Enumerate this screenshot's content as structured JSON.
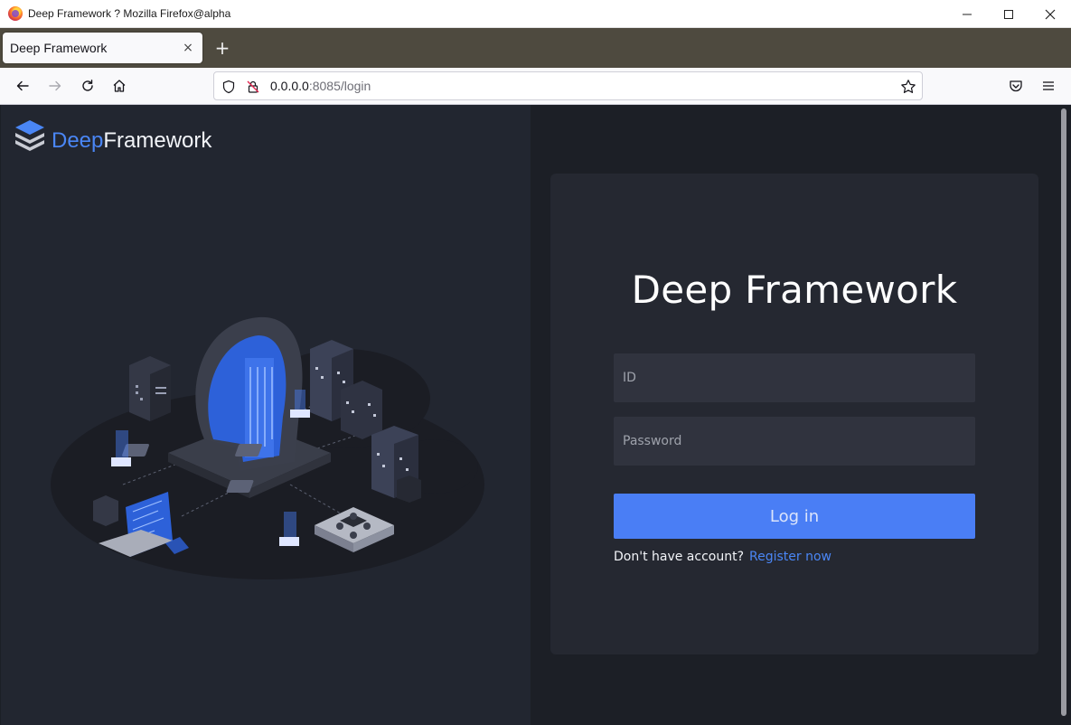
{
  "window": {
    "title": "Deep Framework ? Mozilla Firefox@alpha",
    "minimize_glyph": "—",
    "maximize_glyph": "☐",
    "close_glyph": "✕"
  },
  "tabs": [
    {
      "label": "Deep Framework",
      "close_glyph": "×"
    }
  ],
  "new_tab_glyph": "+",
  "navbar": {
    "back_icon": "arrow-left-icon",
    "forward_icon": "arrow-right-icon",
    "reload_icon": "reload-icon",
    "home_icon": "home-icon",
    "url_host": "0.0.0.0",
    "url_rest": ":8085/login",
    "pocket_icon": "pocket-icon",
    "menu_icon": "hamburger-menu-icon"
  },
  "brand": {
    "deep": "Deep",
    "framework": "Framework"
  },
  "login": {
    "title": "Deep Framework",
    "id_placeholder": "ID",
    "password_placeholder": "Password",
    "login_button": "Log in",
    "no_account_text": "Don't have account?",
    "register_link": "Register now"
  },
  "colors": {
    "accent": "#4a7ef5",
    "link": "#4a86f5",
    "page_bg": "#1c1f26",
    "left_bg": "#222630",
    "card_bg": "#252831",
    "field_bg": "#30333e"
  }
}
